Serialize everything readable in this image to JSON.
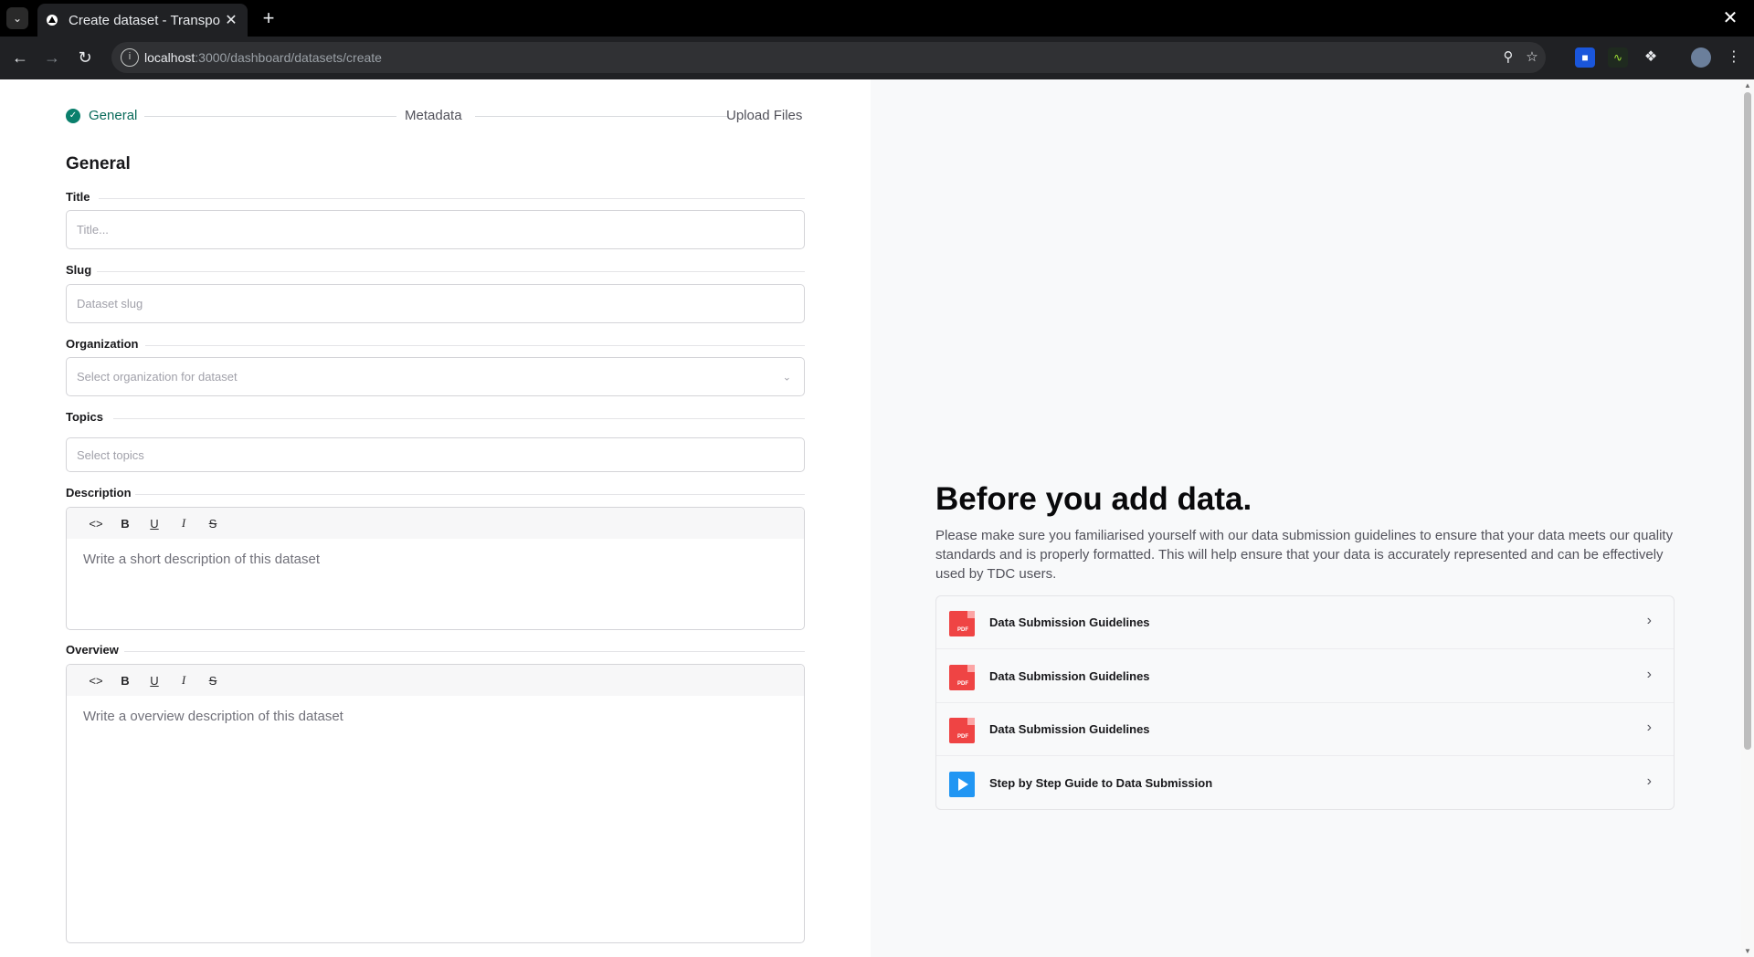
{
  "browser": {
    "tab_title": "Create dataset - Transpo",
    "url_host": "localhost",
    "url_path": ":3000/dashboard/datasets/create"
  },
  "stepper": {
    "steps": [
      "General",
      "Metadata",
      "Upload Files"
    ],
    "active_color": "#0a7f6c"
  },
  "form": {
    "section_title": "General",
    "title_label": "Title",
    "title_placeholder": "Title...",
    "slug_label": "Slug",
    "slug_placeholder": "Dataset slug",
    "organization_label": "Organization",
    "organization_placeholder": "Select organization for dataset",
    "topics_label": "Topics",
    "topics_placeholder": "Select topics",
    "description_label": "Description",
    "description_placeholder": "Write a short description of this dataset",
    "overview_label": "Overview",
    "overview_placeholder": "Write a overview description of this dataset",
    "editor_tools": [
      "<>",
      "B",
      "U",
      "I",
      "S"
    ]
  },
  "info": {
    "heading": "Before you add data.",
    "body": "Please make sure you familiarised yourself with our data submission guidelines to ensure that your data meets our quality standards and is properly formatted. This will help ensure that your data is accurately represented and can be effectively used by TDC users.",
    "resources": [
      {
        "label": "Data Submission Guidelines",
        "icon": "pdf-icon"
      },
      {
        "label": "Data Submission Guidelines",
        "icon": "pdf-icon"
      },
      {
        "label": "Data Submission Guidelines",
        "icon": "pdf-icon"
      },
      {
        "label": "Step by Step Guide to Data Submission",
        "icon": "video-icon"
      }
    ]
  }
}
